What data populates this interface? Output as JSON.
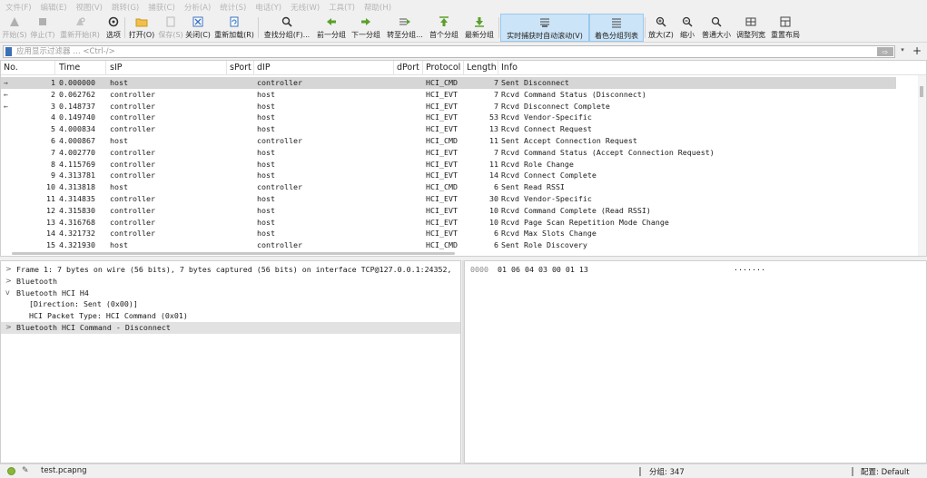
{
  "menu": [
    "文件(F)",
    "编辑(E)",
    "视图(V)",
    "跳转(G)",
    "捕获(C)",
    "分析(A)",
    "统计(S)",
    "电话(Y)",
    "无线(W)",
    "工具(T)",
    "帮助(H)"
  ],
  "toolbar": [
    {
      "label": "开始(S)",
      "icon": "shark-fin-icon",
      "disabled": true
    },
    {
      "label": "停止(T)",
      "icon": "stop-icon",
      "disabled": true
    },
    {
      "label": "重新开始(R)",
      "icon": "restart-icon",
      "disabled": true
    },
    {
      "label": "选项",
      "icon": "gear-icon",
      "disabled": false
    },
    {
      "label": "打开(O)",
      "icon": "folder-icon",
      "disabled": false
    },
    {
      "label": "保存(S)",
      "icon": "file-save-icon",
      "disabled": true
    },
    {
      "label": "关闭(C)",
      "icon": "close-file-icon",
      "disabled": false
    },
    {
      "label": "重新加载(R)",
      "icon": "reload-icon",
      "disabled": false
    },
    {
      "label": "查找分组(F)...",
      "icon": "search-icon",
      "disabled": false
    },
    {
      "label": "前一分组",
      "icon": "arrow-left-icon",
      "disabled": false
    },
    {
      "label": "下一分组",
      "icon": "arrow-right-icon",
      "disabled": false
    },
    {
      "label": "转至分组...",
      "icon": "go-to-icon",
      "disabled": false
    },
    {
      "label": "首个分组",
      "icon": "first-packet-icon",
      "disabled": false
    },
    {
      "label": "最新分组",
      "icon": "last-packet-icon",
      "disabled": false
    },
    {
      "label": "实时捕获时自动滚动(V)",
      "icon": "autoscroll-icon",
      "disabled": false,
      "active": true
    },
    {
      "label": "着色分组列表",
      "icon": "colorize-icon",
      "disabled": false,
      "active": true
    },
    {
      "label": "放大(Z)",
      "icon": "zoom-in-icon",
      "disabled": false
    },
    {
      "label": "缩小",
      "icon": "zoom-out-icon",
      "disabled": false
    },
    {
      "label": "普通大小",
      "icon": "zoom-normal-icon",
      "disabled": false
    },
    {
      "label": "调整列宽",
      "icon": "resize-columns-icon",
      "disabled": false
    },
    {
      "label": "重置布局",
      "icon": "layout-icon",
      "disabled": false
    }
  ],
  "filter": {
    "placeholder": "应用显示过滤器 … <Ctrl-/>",
    "value": ""
  },
  "columns": [
    "No.",
    "Time",
    "sIP",
    "sPort",
    "dIP",
    "dPort",
    "Protocol",
    "Length",
    "Info"
  ],
  "packets": [
    {
      "no": "1",
      "time": "0.000000",
      "sip": "host",
      "dip": "controller",
      "proto": "HCI_CMD",
      "len": "7",
      "info": "Sent Disconnect",
      "arrow": "→",
      "selected": true
    },
    {
      "no": "2",
      "time": "0.062762",
      "sip": "controller",
      "dip": "host",
      "proto": "HCI_EVT",
      "len": "7",
      "info": "Rcvd Command Status (Disconnect)",
      "arrow": "←"
    },
    {
      "no": "3",
      "time": "0.148737",
      "sip": "controller",
      "dip": "host",
      "proto": "HCI_EVT",
      "len": "7",
      "info": "Rcvd Disconnect Complete",
      "arrow": "←"
    },
    {
      "no": "4",
      "time": "0.149740",
      "sip": "controller",
      "dip": "host",
      "proto": "HCI_EVT",
      "len": "53",
      "info": "Rcvd Vendor-Specific",
      "arrow": ""
    },
    {
      "no": "5",
      "time": "4.000834",
      "sip": "controller",
      "dip": "host",
      "proto": "HCI_EVT",
      "len": "13",
      "info": "Rcvd Connect Request",
      "arrow": ""
    },
    {
      "no": "6",
      "time": "4.000867",
      "sip": "host",
      "dip": "controller",
      "proto": "HCI_CMD",
      "len": "11",
      "info": "Sent Accept Connection Request",
      "arrow": ""
    },
    {
      "no": "7",
      "time": "4.002770",
      "sip": "controller",
      "dip": "host",
      "proto": "HCI_EVT",
      "len": "7",
      "info": "Rcvd Command Status (Accept Connection Request)",
      "arrow": ""
    },
    {
      "no": "8",
      "time": "4.115769",
      "sip": "controller",
      "dip": "host",
      "proto": "HCI_EVT",
      "len": "11",
      "info": "Rcvd Role Change",
      "arrow": ""
    },
    {
      "no": "9",
      "time": "4.313781",
      "sip": "controller",
      "dip": "host",
      "proto": "HCI_EVT",
      "len": "14",
      "info": "Rcvd Connect Complete",
      "arrow": ""
    },
    {
      "no": "10",
      "time": "4.313818",
      "sip": "host",
      "dip": "controller",
      "proto": "HCI_CMD",
      "len": "6",
      "info": "Sent Read RSSI",
      "arrow": ""
    },
    {
      "no": "11",
      "time": "4.314835",
      "sip": "controller",
      "dip": "host",
      "proto": "HCI_EVT",
      "len": "30",
      "info": "Rcvd Vendor-Specific",
      "arrow": ""
    },
    {
      "no": "12",
      "time": "4.315830",
      "sip": "controller",
      "dip": "host",
      "proto": "HCI_EVT",
      "len": "10",
      "info": "Rcvd Command Complete (Read RSSI)",
      "arrow": ""
    },
    {
      "no": "13",
      "time": "4.316768",
      "sip": "controller",
      "dip": "host",
      "proto": "HCI_EVT",
      "len": "10",
      "info": "Rcvd Page Scan Repetition Mode Change",
      "arrow": ""
    },
    {
      "no": "14",
      "time": "4.321732",
      "sip": "controller",
      "dip": "host",
      "proto": "HCI_EVT",
      "len": "6",
      "info": "Rcvd Max Slots Change",
      "arrow": ""
    },
    {
      "no": "15",
      "time": "4.321930",
      "sip": "host",
      "dip": "controller",
      "proto": "HCI_CMD",
      "len": "6",
      "info": "Sent Role Discovery",
      "arrow": ""
    }
  ],
  "details": [
    {
      "text": "Frame 1: 7 bytes on wire (56 bits), 7 bytes captured (56 bits) on interface TCP@127.0.0.1:24352,",
      "level": 0,
      "toggle": ">"
    },
    {
      "text": "Bluetooth",
      "level": 0,
      "toggle": ">"
    },
    {
      "text": "Bluetooth HCI H4",
      "level": 0,
      "toggle": "v"
    },
    {
      "text": "[Direction: Sent (0x00)]",
      "level": 1,
      "toggle": ""
    },
    {
      "text": "HCI Packet Type: HCI Command (0x01)",
      "level": 1,
      "toggle": ""
    },
    {
      "text": "Bluetooth HCI Command - Disconnect",
      "level": 0,
      "toggle": ">",
      "selected": true
    }
  ],
  "bytes": {
    "offset": "0000",
    "hex": "01 06 04 03 00 01 13",
    "ascii": "·······"
  },
  "status": {
    "file": "test.pcapng",
    "packets": "分组: 347",
    "profile": "配置: Default"
  },
  "filter_buttons": {
    "apply": "⇨",
    "dropdown": "▾",
    "add": "+"
  }
}
